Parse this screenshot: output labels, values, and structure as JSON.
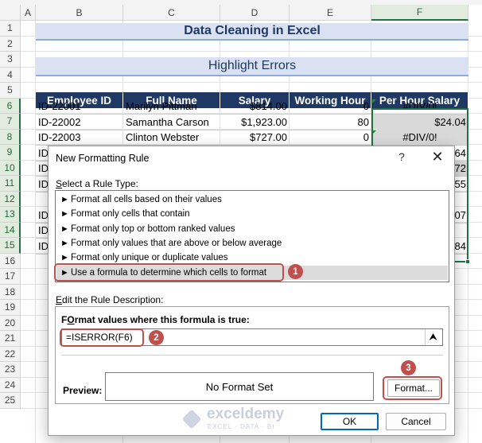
{
  "columns": [
    "A",
    "B",
    "C",
    "D",
    "E",
    "F"
  ],
  "rows": [
    "1",
    "2",
    "3",
    "4",
    "5",
    "6",
    "7",
    "8",
    "9",
    "10",
    "11",
    "12",
    "13",
    "14",
    "15",
    "16",
    "17",
    "18",
    "19",
    "20",
    "21",
    "22",
    "23",
    "24",
    "25"
  ],
  "sheet": {
    "title": "Data Cleaning in Excel",
    "subtitle": "Highlight Errors",
    "headers": [
      "Employee ID",
      "Full Name",
      "Salary",
      "Working Hour",
      "Per Hour Salary"
    ],
    "data_rows": [
      [
        "ID-22001",
        "Marilyn Pittman",
        "$814.00",
        "0",
        "#DIV/0!"
      ],
      [
        "ID-22002",
        "Samantha Carson",
        "$1,923.00",
        "80",
        "$24.04"
      ],
      [
        "ID-22003",
        "Clinton Webster",
        "$727.00",
        "0",
        "#DIV/0!"
      ]
    ],
    "partial_visible": {
      "row9": "ID",
      "row10": "ID",
      "row11": "ID",
      "row13": "ID",
      "row14": "ID",
      "row15": "ID",
      "f9": "64",
      "f10": "72",
      "f11": "55",
      "f13": "07",
      "f15": "84"
    }
  },
  "dialog": {
    "title": "New Formatting Rule",
    "help": "?",
    "close": "✕",
    "rule_type_label_ul": "S",
    "rule_type_label": "elect a Rule Type:",
    "rules": [
      "Format all cells based on their values",
      "Format only cells that contain",
      "Format only top or bottom ranked values",
      "Format only values that are above or below average",
      "Format only unique or duplicate values",
      "Use a formula to determine which cells to format"
    ],
    "rule_arrow": "►",
    "desc_label_ul": "E",
    "desc_label": "dit the Rule Description:",
    "formula_label_ul": "O",
    "formula_label_pre": "F",
    "formula_label": "rmat values where this formula is true:",
    "formula_value": "=ISERROR(F6)",
    "formula_btn": "⮝",
    "preview_label": "Preview:",
    "preview_text": "No Format Set",
    "format_button": "Format...",
    "ok": "OK",
    "cancel": "Cancel"
  },
  "callouts": [
    "1",
    "2",
    "3"
  ],
  "watermark": {
    "name": "exceldemy",
    "tagline": "EXCEL · DATA · BI"
  },
  "colors": {
    "header_fill": "#1f3864",
    "band_fill": "#d9e1f2",
    "accent": "#c0504d",
    "selection": "#217346"
  }
}
